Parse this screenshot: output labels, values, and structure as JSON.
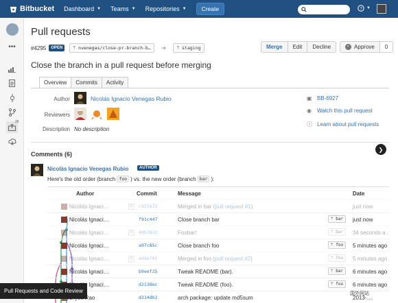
{
  "topbar": {
    "brand": "Bitbucket",
    "nav": [
      {
        "label": "Dashboard"
      },
      {
        "label": "Teams"
      },
      {
        "label": "Repositories"
      }
    ],
    "create_label": "Create",
    "help_icon": "help-icon"
  },
  "pr": {
    "title": "Pull requests",
    "id": "#4295",
    "status": "OPEN",
    "source_branch": "nvenegas/close-pr-branch-b…",
    "target_branch": "staging",
    "actions": {
      "merge": "Merge",
      "edit": "Edit",
      "decline": "Decline",
      "approve": "Approve",
      "approve_count": "0"
    },
    "subtitle": "Close the branch in a pull request before merging",
    "tabs": [
      "Overview",
      "Commits",
      "Activity"
    ],
    "author_label": "Author",
    "author_name": "Nicolás Ignacio Venegas Rubio",
    "reviewers_label": "Reviewers",
    "description_label": "Description",
    "description": "No description",
    "side_links": {
      "issue": "BB-6927",
      "watch": "Watch this pull request",
      "learn": "Learn about pull requests"
    }
  },
  "comments": {
    "title": "Comments (6)",
    "author": "Nicolás Ignacio Venegas Rubio",
    "badge": "AUTHOR",
    "text_a": "Here's the old order (branch",
    "code_a": "foo",
    "text_b": ") vs. the new order (branch",
    "code_b": "bar",
    "text_c": "):"
  },
  "commit_table": {
    "headers": {
      "author": "Author",
      "commit": "Commit",
      "message": "Message",
      "date": "Date"
    },
    "rows": [
      {
        "author": "Nicolás Ignaci…",
        "m": "M",
        "hash": "c527e72",
        "msg": "Merged in bar (",
        "link": "pull request #1",
        "msg_end": ")",
        "branch": "",
        "date": "just now",
        "faded": true
      },
      {
        "author": "Nicolás Ignaci…",
        "m": "",
        "hash": "f91c447",
        "msg": "Close branch bar",
        "link": "",
        "msg_end": "",
        "branch": "bar",
        "date": "just now",
        "faded": false
      },
      {
        "author": "Nicolás Ignaci…",
        "m": "M",
        "hash": "48b7633",
        "msg": "Foobar!",
        "link": "",
        "msg_end": "",
        "branch": "bar",
        "date": "34 seconds a…",
        "faded": true
      },
      {
        "author": "Nicolás Ignaci…",
        "m": "",
        "hash": "a97c85c",
        "msg": "Close branch foo",
        "link": "",
        "msg_end": "",
        "branch": "foo",
        "date": "5 minutes ago",
        "faded": false
      },
      {
        "author": "Nicolás Ignaci…",
        "m": "M",
        "hash": "edde701",
        "msg": "Merged in foo (",
        "link": "pull request #2",
        "msg_end": ")",
        "branch": "foo",
        "date": "5 minutes ago",
        "faded": true
      },
      {
        "author": "Nicolás Ignaci…",
        "m": "",
        "hash": "b9eef25",
        "msg": "Tweak README (bar).",
        "link": "",
        "msg_end": "",
        "branch": "bar",
        "date": "6 minutes ago",
        "faded": false
      },
      {
        "author": "Nicolás Ignaci…",
        "m": "",
        "hash": "d2138ec",
        "msg": "Tweak README (foo).",
        "link": "",
        "msg_end": "",
        "branch": "foo",
        "date": "6 minutes ago",
        "faded": false
      },
      {
        "author": "Bryce Rao",
        "m": "",
        "hash": "d314db2",
        "msg": "arch package: update md5sum",
        "link": "",
        "msg_end": "",
        "branch": "",
        "date": "2013-…",
        "faded": false
      }
    ]
  },
  "tooltip": "Pull Requests and Code Review",
  "watermark": "国外网站",
  "colors": {
    "brand": "#205081",
    "link": "#3572b0"
  }
}
